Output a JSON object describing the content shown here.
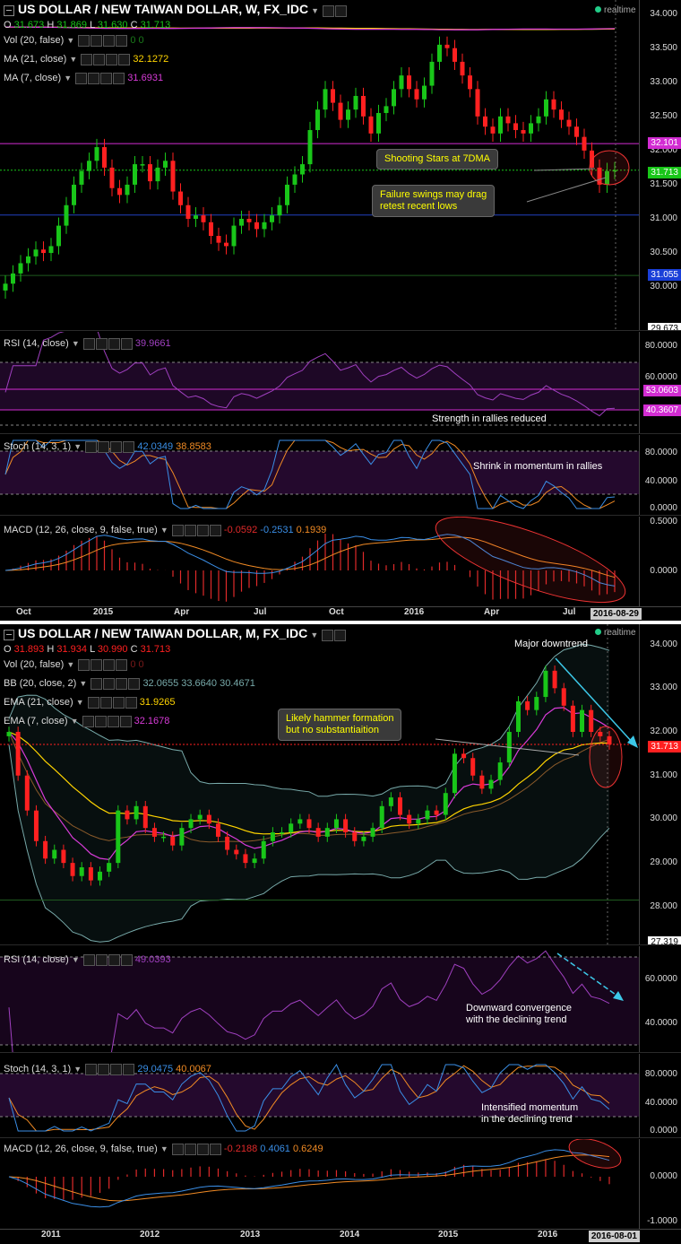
{
  "colors": {
    "up": "#19c619",
    "down": "#ff2020",
    "ma21": "#ffd400",
    "ma7": "#d83bd8",
    "rsi": "#a040c0",
    "stochK": "#3a8ee6",
    "stochD": "#f08a24",
    "macd": "#3a8ee6",
    "signal": "#f08a24",
    "hist": "#e02a2a",
    "hline": "#d22cd2",
    "bb": "#78aaaa"
  },
  "weekly": {
    "header": {
      "title": "US DOLLAR / NEW TAIWAN DOLLAR, W, FX_IDC",
      "o_label": "O",
      "o": "31.673",
      "h_label": "H",
      "h": "31.869",
      "l_label": "L",
      "l": "31.630",
      "c_label": "C",
      "c": "31.713"
    },
    "realtime": "realtime",
    "legend": {
      "vol": "Vol (20, false)",
      "vol_val": "0  0",
      "ma21": "MA (21, close)",
      "ma21_val": "32.1272",
      "ma7": "MA (7, close)",
      "ma7_val": "31.6931"
    },
    "price_ticks": [
      "34.000",
      "33.500",
      "33.000",
      "32.500",
      "32.000",
      "31.500",
      "31.000",
      "30.500",
      "30.000"
    ],
    "tags": {
      "hline": "32.101",
      "last": "31.713",
      "low": "31.055",
      "bottom": "29.673"
    },
    "callouts": {
      "stars": "Shooting Stars at 7DMA",
      "failure": "Failure swings may drag\nretest recent lows"
    },
    "rsi": {
      "label": "RSI (14, close)",
      "value": "39.9661",
      "ticks": [
        "80.0000",
        "60.0000"
      ],
      "tag1": "53.0603",
      "tag2": "40.3607",
      "note": "Strength in rallies reduced"
    },
    "stoch": {
      "label": "Stoch (14, 3, 1)",
      "k": "42.0349",
      "d": "38.8583",
      "ticks": [
        "80.0000",
        "40.0000",
        "0.0000"
      ],
      "note": "Shrink in momentum in rallies"
    },
    "macd": {
      "label": "MACD (12, 26, close, 9, false, true)",
      "macd": "-0.0592",
      "signal": "-0.2531",
      "hist": "0.1939",
      "ticks": [
        "0.5000",
        "0.0000"
      ]
    },
    "xticks": [
      "Oct",
      "2015",
      "Apr",
      "Jul",
      "Oct",
      "2016",
      "Apr",
      "Jul"
    ],
    "date_tag": "2016-08-29"
  },
  "monthly": {
    "header": {
      "title": "US DOLLAR / NEW TAIWAN DOLLAR, M, FX_IDC",
      "o_label": "O",
      "o": "31.893",
      "h_label": "H",
      "h": "31.934",
      "l_label": "L",
      "l": "30.990",
      "c_label": "C",
      "c": "31.713"
    },
    "realtime": "realtime",
    "legend": {
      "vol": "Vol (20, false)",
      "vol_val": "0  0",
      "bb": "BB (20, close, 2)",
      "bb_vals": "32.0655  33.6640  30.4671",
      "ema21": "EMA (21, close)",
      "ema21_val": "31.9265",
      "ema7": "EMA (7, close)",
      "ema7_val": "32.1678"
    },
    "price_ticks": [
      "34.000",
      "33.000",
      "32.000",
      "31.000",
      "30.000",
      "29.000",
      "28.000"
    ],
    "tags": {
      "last": "31.713",
      "bottom": "27.319"
    },
    "callouts": {
      "hammer": "Likely hammer formation\nbut no substantiaition"
    },
    "major_note": "Major downtrend",
    "rsi": {
      "label": "RSI (14, close)",
      "value": "49.0393",
      "ticks": [
        "60.0000",
        "40.0000"
      ],
      "note": "Downward convergence\nwith the declining trend"
    },
    "stoch": {
      "label": "Stoch (14, 3, 1)",
      "k": "29.0475",
      "d": "40.0067",
      "ticks": [
        "80.0000",
        "40.0000",
        "0.0000"
      ],
      "note": "Intensified momentum\nin the declining trend"
    },
    "macd": {
      "label": "MACD (12, 26, close, 9, false, true)",
      "macd": "-0.2188",
      "signal": "0.4061",
      "hist": "0.6249",
      "ticks": [
        "0.0000",
        "-1.0000"
      ]
    },
    "xticks": [
      "2011",
      "2012",
      "2013",
      "2014",
      "2015",
      "2016"
    ],
    "date_tag": "2016-08-01"
  },
  "chart_data": [
    {
      "type": "candlestick",
      "title": "US DOLLAR / NEW TAIWAN DOLLAR, W, FX_IDC",
      "ylim": [
        29.673,
        34.1
      ],
      "x_labels": [
        "Oct",
        "2015",
        "Apr",
        "Jul",
        "Oct",
        "2016",
        "Apr",
        "Jul"
      ],
      "closes": [
        30.05,
        30.2,
        30.35,
        30.45,
        30.55,
        30.5,
        30.6,
        30.9,
        31.2,
        31.5,
        31.7,
        31.85,
        32.05,
        31.75,
        31.45,
        31.35,
        31.5,
        31.8,
        31.8,
        31.55,
        31.75,
        31.85,
        31.4,
        31.2,
        31.0,
        31.05,
        30.95,
        30.75,
        30.65,
        30.6,
        30.9,
        31.0,
        30.95,
        30.85,
        30.95,
        31.05,
        31.2,
        31.5,
        31.65,
        31.8,
        32.3,
        32.6,
        32.9,
        32.7,
        32.45,
        32.6,
        32.8,
        32.5,
        32.25,
        32.55,
        32.65,
        32.9,
        33.1,
        32.9,
        32.75,
        32.95,
        33.3,
        33.55,
        33.5,
        33.3,
        33.1,
        32.9,
        32.5,
        32.35,
        32.25,
        32.5,
        32.4,
        32.3,
        32.25,
        32.4,
        32.5,
        32.75,
        32.6,
        32.45,
        32.35,
        32.2,
        32.0,
        31.75,
        31.5,
        31.7,
        31.713
      ],
      "series": [
        {
          "name": "MA (21, close)",
          "last": 32.1272
        },
        {
          "name": "MA (7, close)",
          "last": 31.6931
        }
      ],
      "hlines": [
        32.101,
        31.713,
        31.055
      ]
    },
    {
      "type": "line",
      "title": "RSI (14, close)",
      "ylim": [
        20,
        90
      ],
      "last": 39.9661,
      "hlines": [
        70,
        53.0603,
        40.3607,
        30
      ]
    },
    {
      "type": "line",
      "title": "Stoch (14, 3, 1)",
      "ylim": [
        0,
        100
      ],
      "series": [
        {
          "name": "%K",
          "last": 42.0349
        },
        {
          "name": "%D",
          "last": 38.8583
        }
      ],
      "hlines": [
        80,
        20
      ]
    },
    {
      "type": "bar",
      "title": "MACD (12, 26, close, 9, false, true)",
      "ylim": [
        -0.5,
        0.55
      ],
      "series": [
        {
          "name": "MACD",
          "last": -0.0592
        },
        {
          "name": "Signal",
          "last": -0.2531
        },
        {
          "name": "Histogram",
          "last": 0.1939
        }
      ]
    },
    {
      "type": "candlestick",
      "title": "US DOLLAR / NEW TAIWAN DOLLAR, M, FX_IDC",
      "ylim": [
        27.319,
        34.3
      ],
      "x_labels": [
        "2011",
        "2012",
        "2013",
        "2014",
        "2015",
        "2016"
      ],
      "closes": [
        32.0,
        31.0,
        30.2,
        29.5,
        29.1,
        29.3,
        29.0,
        28.7,
        28.9,
        28.6,
        28.8,
        29.0,
        30.2,
        30.0,
        30.3,
        29.8,
        29.6,
        29.6,
        29.4,
        29.8,
        30.0,
        30.1,
        29.9,
        29.6,
        29.3,
        29.2,
        29.0,
        29.1,
        29.5,
        29.7,
        29.7,
        29.9,
        30.0,
        29.8,
        29.6,
        29.8,
        30.0,
        29.7,
        29.5,
        29.6,
        29.8,
        30.3,
        30.5,
        30.1,
        29.9,
        30.0,
        30.2,
        30.1,
        30.6,
        31.5,
        31.4,
        31.0,
        30.7,
        30.9,
        31.3,
        32.0,
        32.7,
        32.5,
        32.8,
        33.4,
        33.0,
        32.6,
        32.0,
        32.5,
        32.0,
        31.9,
        31.713
      ],
      "series": [
        {
          "name": "BB upper",
          "last": 33.664
        },
        {
          "name": "BB basis",
          "last": 32.0655
        },
        {
          "name": "BB lower",
          "last": 30.4671
        },
        {
          "name": "EMA (21, close)",
          "last": 31.9265
        },
        {
          "name": "EMA (7, close)",
          "last": 32.1678
        }
      ],
      "hlines": [
        31.713
      ]
    },
    {
      "type": "line",
      "title": "RSI (14, close)",
      "ylim": [
        30,
        75
      ],
      "last": 49.0393
    },
    {
      "type": "line",
      "title": "Stoch (14, 3, 1)",
      "ylim": [
        0,
        100
      ],
      "series": [
        {
          "name": "%K",
          "last": 29.0475
        },
        {
          "name": "%D",
          "last": 40.0067
        }
      ],
      "hlines": [
        80,
        20
      ]
    },
    {
      "type": "bar",
      "title": "MACD (12, 26, close, 9, false, true)",
      "ylim": [
        -1.0,
        0.3
      ],
      "series": [
        {
          "name": "MACD",
          "last": -0.2188
        },
        {
          "name": "Signal",
          "last": 0.4061
        },
        {
          "name": "Histogram",
          "last": 0.6249
        }
      ]
    }
  ]
}
